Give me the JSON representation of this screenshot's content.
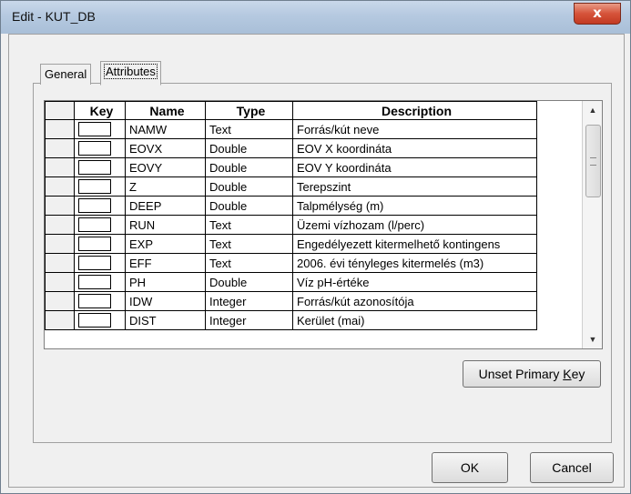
{
  "window": {
    "title": "Edit - KUT_DB",
    "close_label": "x"
  },
  "tabs": [
    {
      "label": "General",
      "selected": false
    },
    {
      "label": "Attributes",
      "selected": true
    }
  ],
  "table": {
    "columns": [
      "",
      "Key",
      "Name",
      "Type",
      "Description"
    ],
    "rows": [
      {
        "key": false,
        "name": "NAMW",
        "type": "Text",
        "description": "Forrás/kút neve"
      },
      {
        "key": false,
        "name": "EOVX",
        "type": "Double",
        "description": "EOV X koordináta"
      },
      {
        "key": false,
        "name": "EOVY",
        "type": "Double",
        "description": "EOV Y koordináta"
      },
      {
        "key": false,
        "name": "Z",
        "type": "Double",
        "description": "Terepszint"
      },
      {
        "key": false,
        "name": "DEEP",
        "type": "Double",
        "description": "Talpmélység (m)"
      },
      {
        "key": false,
        "name": "RUN",
        "type": "Text",
        "description": "Üzemi vízhozam (l/perc)"
      },
      {
        "key": false,
        "name": "EXP",
        "type": "Text",
        "description": "Engedélyezett kitermelhető kontingens"
      },
      {
        "key": false,
        "name": "EFF",
        "type": "Text",
        "description": "2006. évi tényleges kitermelés (m3)"
      },
      {
        "key": false,
        "name": "PH",
        "type": "Double",
        "description": "Víz pH-értéke"
      },
      {
        "key": false,
        "name": "IDW",
        "type": "Integer",
        "description": "Forrás/kút azonosítója"
      },
      {
        "key": false,
        "name": "DIST",
        "type": "Integer",
        "description": "Kerület (mai)"
      }
    ]
  },
  "buttons": {
    "unset_primary_key_pre": "Unset Primary ",
    "unset_primary_key_accel": "K",
    "unset_primary_key_post": "ey",
    "ok": "OK",
    "cancel": "Cancel"
  },
  "icons": {
    "scroll_up": "scroll-up-arrow",
    "scroll_down": "scroll-down-arrow",
    "close": "close-x"
  }
}
